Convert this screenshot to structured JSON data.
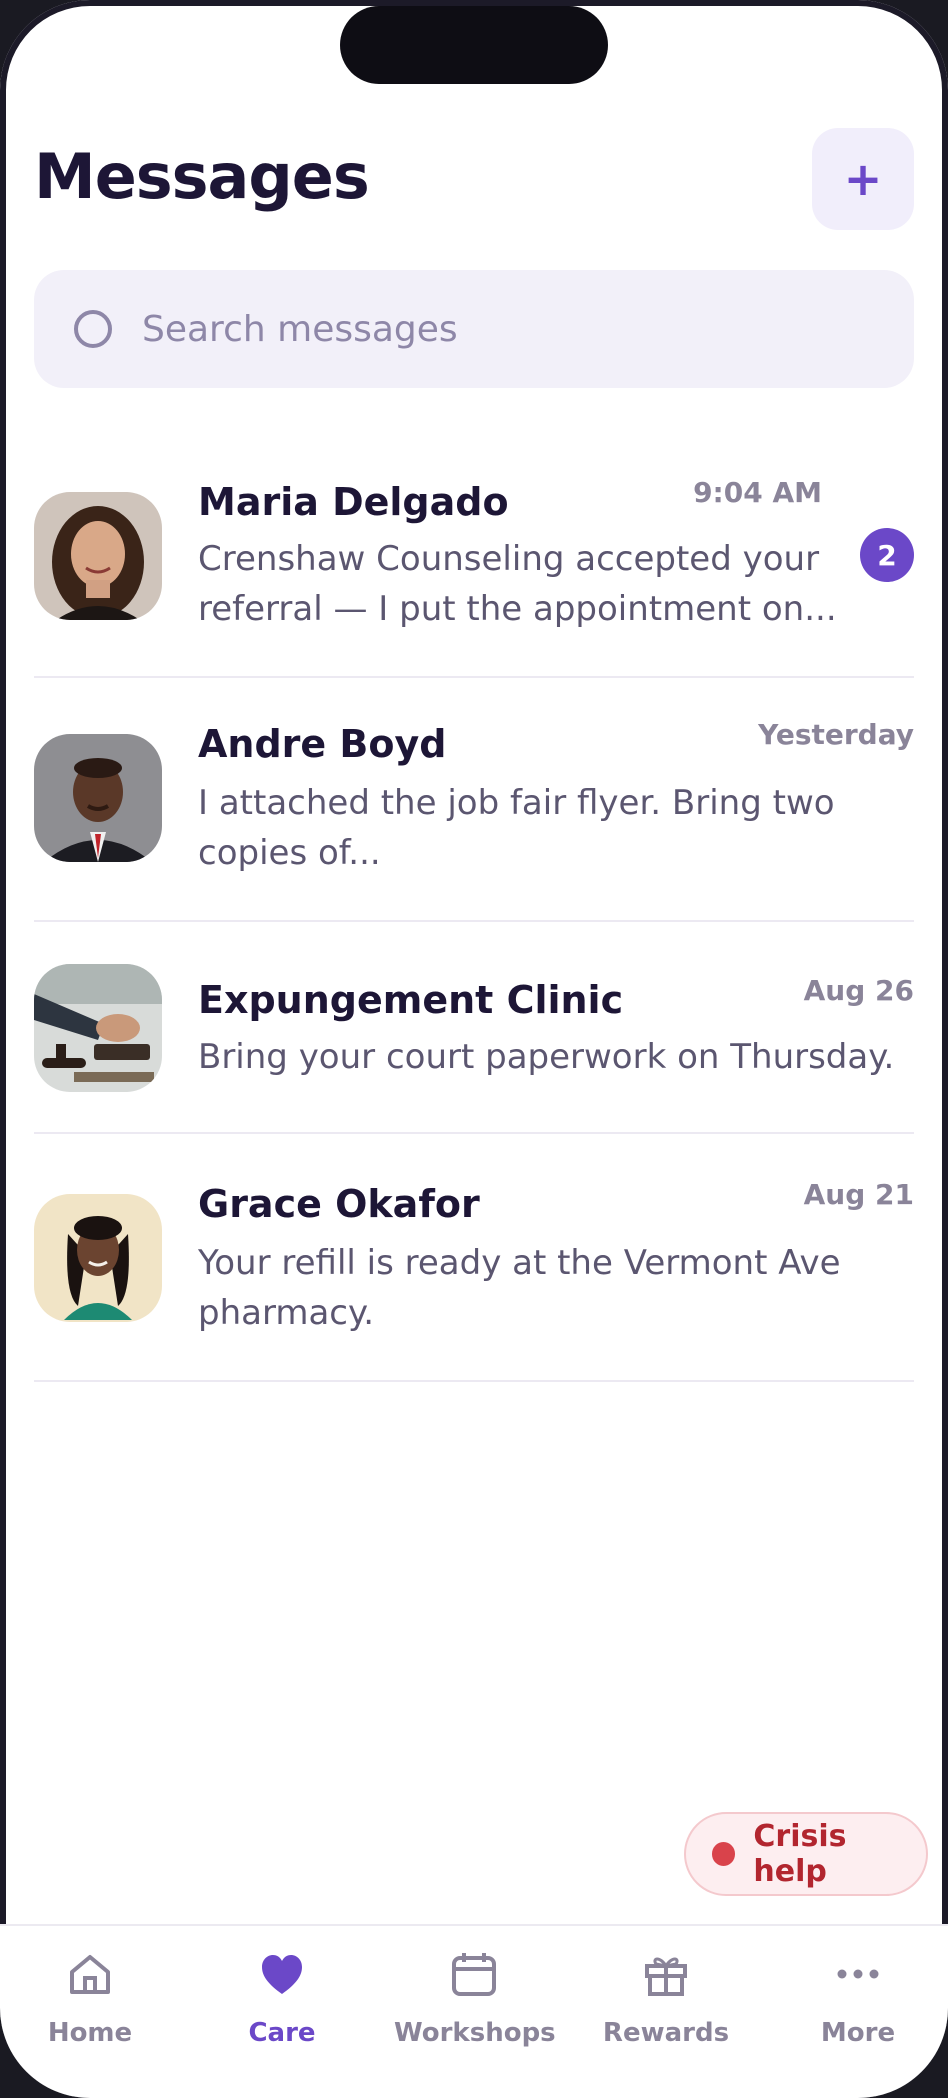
{
  "header": {
    "title": "Messages",
    "new_button_label": "+"
  },
  "search": {
    "placeholder": "Search messages",
    "value": ""
  },
  "conversations": [
    {
      "name": "Maria Delgado",
      "time": "9:04 AM",
      "preview": "Crenshaw Counseling accepted your referral — I put the appointment on...",
      "unread": "2"
    },
    {
      "name": "Andre Boyd",
      "time": "Yesterday",
      "preview": "I attached the job fair flyer. Bring two copies of..."
    },
    {
      "name": "Expungement Clinic",
      "time": "Aug 26",
      "preview": "Bring your court paperwork on Thursday."
    },
    {
      "name": "Grace Okafor",
      "time": "Aug 21",
      "preview": "Your refill is ready at the Vermont Ave pharmacy."
    }
  ],
  "crisis": {
    "label": "Crisis help"
  },
  "tabs": [
    {
      "label": "Home",
      "icon": "home-icon"
    },
    {
      "label": "Care",
      "icon": "heart-icon",
      "active": true
    },
    {
      "label": "Workshops",
      "icon": "calendar-icon"
    },
    {
      "label": "Rewards",
      "icon": "gift-icon"
    },
    {
      "label": "More",
      "icon": "more-dots-icon"
    }
  ],
  "colors": {
    "accent": "#6b48c8",
    "title": "#1d1636",
    "muted": "#8a8499",
    "crisis": "#b2262f"
  }
}
